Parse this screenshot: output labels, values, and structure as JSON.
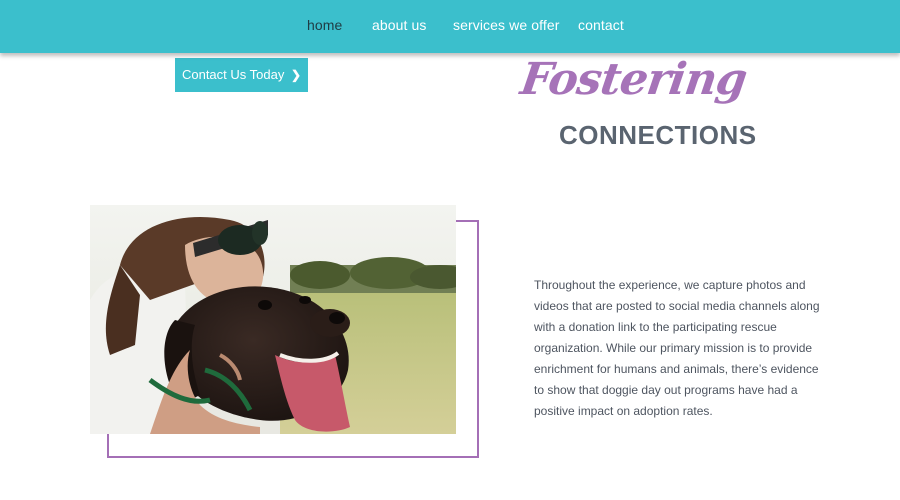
{
  "nav": {
    "items": [
      {
        "label": "home",
        "active": true
      },
      {
        "label": "about us",
        "active": false
      },
      {
        "label": "services we offer",
        "active": false
      },
      {
        "label": "contact",
        "active": false
      }
    ]
  },
  "cta": {
    "label": "Contact Us Today",
    "icon": "chevron-right-icon"
  },
  "hero": {
    "script_title": "Fostering",
    "subtitle": "CONNECTIONS"
  },
  "main": {
    "photo_description_icon": "photo-woman-hugging-dog",
    "paragraph": "Throughout the experience, we capture photos and videos that are posted to social media channels along with a donation link to the participating rescue organization. While our primary mission is to provide enrichment for humans and animals, there’s evidence to show that doggie day out programs have had a positive impact on adoption rates."
  },
  "colors": {
    "brand_teal": "#3bbfcc",
    "accent_purple": "#a673b8",
    "heading_gray": "#5a6470",
    "body_text": "#4e5560"
  }
}
